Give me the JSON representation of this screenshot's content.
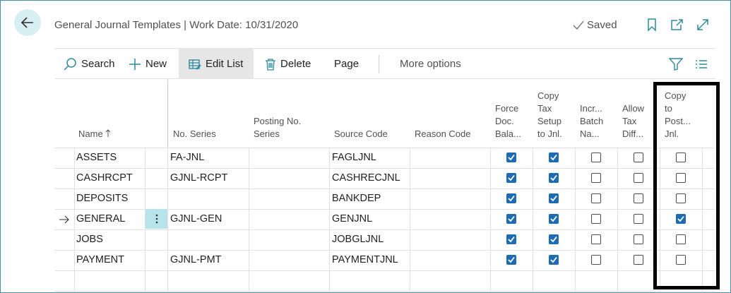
{
  "header": {
    "title": "General Journal Templates | Work Date: 10/31/2020",
    "saved_label": "Saved"
  },
  "toolbar": {
    "search": "Search",
    "new": "New",
    "edit_list": "Edit List",
    "delete": "Delete",
    "page": "Page",
    "more_options": "More options"
  },
  "columns": {
    "name": "Name",
    "no_series": "No. Series",
    "posting_no_series_1": "Posting No.",
    "posting_no_series_2": "Series",
    "source_code": "Source Code",
    "reason_code": "Reason Code",
    "force_doc_1": "Force",
    "force_doc_2": "Doc.",
    "force_doc_3": "Bala...",
    "copy_tax_1": "Copy",
    "copy_tax_2": "Tax",
    "copy_tax_3": "Setup",
    "copy_tax_4": "to Jnl.",
    "incr_batch_1": "Incr...",
    "incr_batch_2": "Batch",
    "incr_batch_3": "Na...",
    "allow_tax_1": "Allow",
    "allow_tax_2": "Tax",
    "allow_tax_3": "Diff...",
    "copy_post_1": "Copy",
    "copy_post_2": "to",
    "copy_post_3": "Post...",
    "copy_post_4": "Jnl."
  },
  "rows": [
    {
      "name": "ASSETS",
      "no_series": "FA-JNL",
      "posting_no_series": "",
      "source_code": "FAGLJNL",
      "reason_code": "",
      "force_doc": true,
      "copy_tax": true,
      "incr_batch": false,
      "allow_tax": false,
      "copy_post": false
    },
    {
      "name": "CASHRCPT",
      "no_series": "GJNL-RCPT",
      "posting_no_series": "",
      "source_code": "CASHRECJNL",
      "reason_code": "",
      "force_doc": true,
      "copy_tax": true,
      "incr_batch": false,
      "allow_tax": false,
      "copy_post": false
    },
    {
      "name": "DEPOSITS",
      "no_series": "",
      "posting_no_series": "",
      "source_code": "BANKDEP",
      "reason_code": "",
      "force_doc": true,
      "copy_tax": true,
      "incr_batch": false,
      "allow_tax": false,
      "copy_post": false
    },
    {
      "name": "GENERAL",
      "no_series": "GJNL-GEN",
      "posting_no_series": "",
      "source_code": "GENJNL",
      "reason_code": "",
      "force_doc": true,
      "copy_tax": true,
      "incr_batch": false,
      "allow_tax": false,
      "copy_post": true
    },
    {
      "name": "JOBS",
      "no_series": "",
      "posting_no_series": "",
      "source_code": "JOBGLJNL",
      "reason_code": "",
      "force_doc": true,
      "copy_tax": true,
      "incr_batch": false,
      "allow_tax": false,
      "copy_post": false
    },
    {
      "name": "PAYMENT",
      "no_series": "GJNL-PMT",
      "posting_no_series": "",
      "source_code": "PAYMENTJNL",
      "reason_code": "",
      "force_doc": true,
      "copy_tax": true,
      "incr_batch": false,
      "allow_tax": false,
      "copy_post": false
    }
  ],
  "selected_row": 3,
  "colors": {
    "accent": "#1d6bb4",
    "back_button_bg": "#d7eef2",
    "row_menu_bg": "#b7e4ea",
    "icon_teal": "#2a8a9e",
    "frame_border": "#4a8fa0"
  }
}
